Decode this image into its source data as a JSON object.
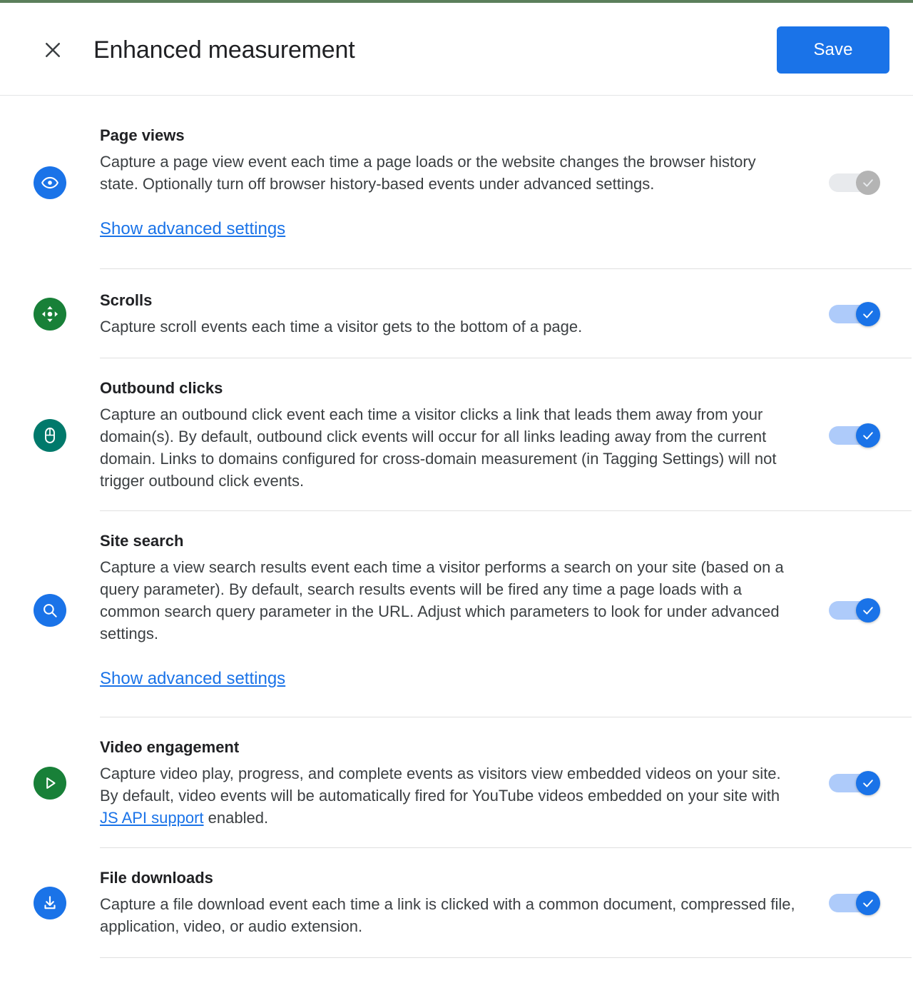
{
  "theme": {
    "accent_bar_color": "#5b7f5b",
    "primary_blue": "#1a73e8",
    "link_blue": "#1a73e8",
    "green": "#188038",
    "teal": "#00796b",
    "divider": "#e0e0e0",
    "disabled_gray": "#b4b4b4"
  },
  "header": {
    "close_icon": "close-icon",
    "title": "Enhanced measurement",
    "save_label": "Save"
  },
  "settings": [
    {
      "id": "page-views",
      "icon": "eye-icon",
      "icon_color": "#1a73e8",
      "title": "Page views",
      "description": "Capture a page view event each time a page loads or the website changes the browser history state. Optionally turn off browser history-based events under advanced settings.",
      "advanced_link": "Show advanced settings",
      "toggle": {
        "on": true,
        "disabled": true
      }
    },
    {
      "id": "scrolls",
      "icon": "scroll-move-icon",
      "icon_color": "#188038",
      "title": "Scrolls",
      "description": "Capture scroll events each time a visitor gets to the bottom of a page.",
      "advanced_link": null,
      "toggle": {
        "on": true,
        "disabled": false
      }
    },
    {
      "id": "outbound-clicks",
      "icon": "mouse-icon",
      "icon_color": "#00796b",
      "title": "Outbound clicks",
      "description": "Capture an outbound click event each time a visitor clicks a link that leads them away from your domain(s). By default, outbound click events will occur for all links leading away from the current domain. Links to domains configured for cross-domain measurement (in Tagging Settings) will not trigger outbound click events.",
      "advanced_link": null,
      "toggle": {
        "on": true,
        "disabled": false
      }
    },
    {
      "id": "site-search",
      "icon": "search-icon",
      "icon_color": "#1a73e8",
      "title": "Site search",
      "description": "Capture a view search results event each time a visitor performs a search on your site (based on a query parameter). By default, search results events will be fired any time a page loads with a common search query parameter in the URL. Adjust which parameters to look for under advanced settings.",
      "advanced_link": "Show advanced settings",
      "toggle": {
        "on": true,
        "disabled": false
      }
    },
    {
      "id": "video-engagement",
      "icon": "play-icon",
      "icon_color": "#188038",
      "title": "Video engagement",
      "description_before_link": "Capture video play, progress, and complete events as visitors view embedded videos on your site. By default, video events will be automatically fired for YouTube videos embedded on your site with ",
      "description_link": "JS API support",
      "description_after_link": " enabled.",
      "advanced_link": null,
      "toggle": {
        "on": true,
        "disabled": false
      }
    },
    {
      "id": "file-downloads",
      "icon": "download-icon",
      "icon_color": "#1a73e8",
      "title": "File downloads",
      "description": "Capture a file download event each time a link is clicked with a common document, compressed file, application, video, or audio extension.",
      "advanced_link": null,
      "toggle": {
        "on": true,
        "disabled": false
      }
    }
  ]
}
